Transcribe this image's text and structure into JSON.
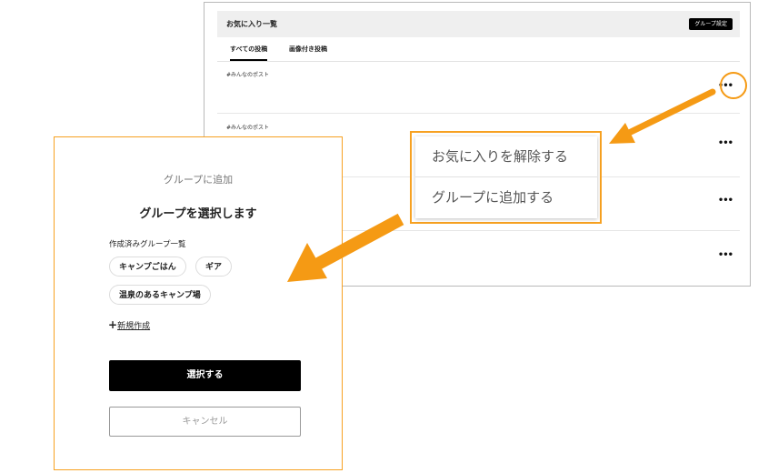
{
  "favorites_page": {
    "title": "お気に入り一覧",
    "group_settings_label": "グループ設定",
    "tabs": [
      {
        "label": "すべての投稿",
        "active": true
      },
      {
        "label": "画像付き投稿",
        "active": false
      }
    ],
    "posts": [
      {
        "tag": "#みんなのポスト",
        "more": "•••"
      },
      {
        "tag": "#みんなのポスト",
        "more": "•••"
      },
      {
        "tag": "",
        "more": "•••"
      },
      {
        "tag": "",
        "more": "•••"
      }
    ]
  },
  "context_menu": {
    "items": [
      {
        "label": "お気に入りを解除する"
      },
      {
        "label": "グループに追加する"
      }
    ]
  },
  "group_modal": {
    "subtitle": "グループに追加",
    "title": "グループを選択します",
    "list_label": "作成済みグループ一覧",
    "groups": [
      {
        "label": "キャンプごはん"
      },
      {
        "label": "ギア"
      },
      {
        "label": "温泉のあるキャンプ場"
      }
    ],
    "new_create_icon": "+",
    "new_create_label": "新規作成",
    "select_button": "選択する",
    "cancel_button": "キャンセル"
  },
  "colors": {
    "accent": "#f7a121",
    "arrow": "#f59a14",
    "button_dark": "#000000"
  }
}
